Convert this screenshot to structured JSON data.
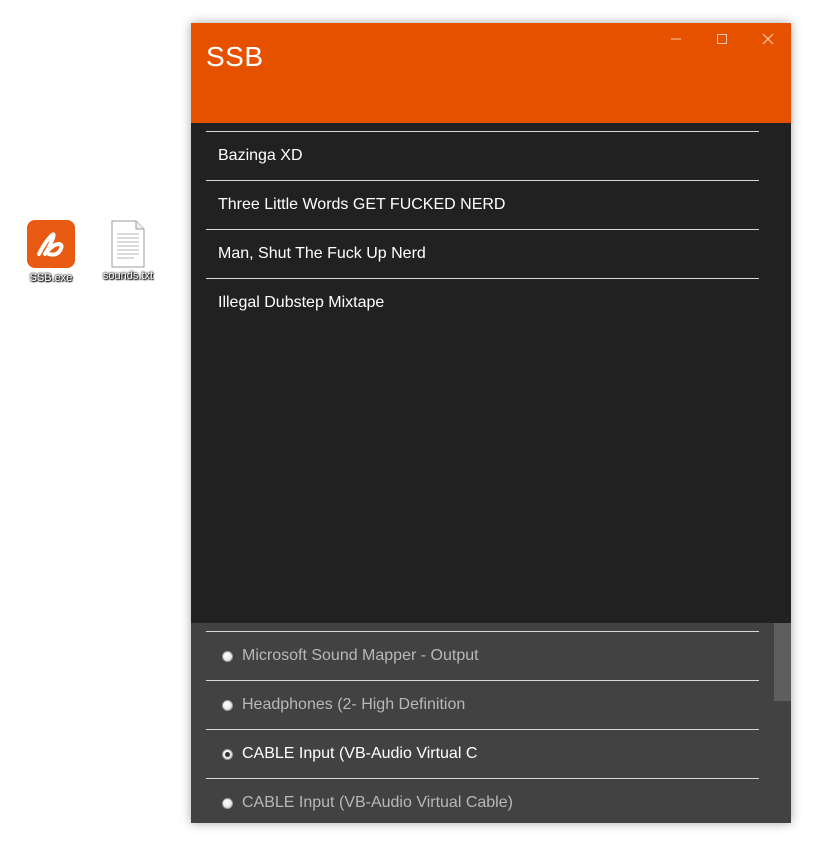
{
  "desktop": {
    "icons": [
      {
        "label": "SSB.exe",
        "icon": "ssb-app-icon",
        "color": "#e85a11"
      },
      {
        "label": "sounds.txt",
        "icon": "text-document-icon"
      }
    ]
  },
  "window": {
    "title": "SSB",
    "titlebar_color": "#e65100",
    "controls": {
      "minimize": "minimize-icon",
      "maximize": "maximize-icon",
      "close": "close-icon"
    }
  },
  "sounds": [
    {
      "label": "Bazinga XD"
    },
    {
      "label": "Three Little Words GET FUCKED NERD"
    },
    {
      "label": "Man, Shut The Fuck Up Nerd"
    },
    {
      "label": "Illegal Dubstep Mixtape"
    }
  ],
  "devices": {
    "items": [
      {
        "label": "Microsoft Sound Mapper - Output",
        "selected": false
      },
      {
        "label": "Headphones (2- High Definition",
        "selected": false
      },
      {
        "label": "CABLE Input (VB-Audio Virtual C",
        "selected": true
      },
      {
        "label": "CABLE Input (VB-Audio Virtual Cable)",
        "selected": false
      }
    ]
  }
}
